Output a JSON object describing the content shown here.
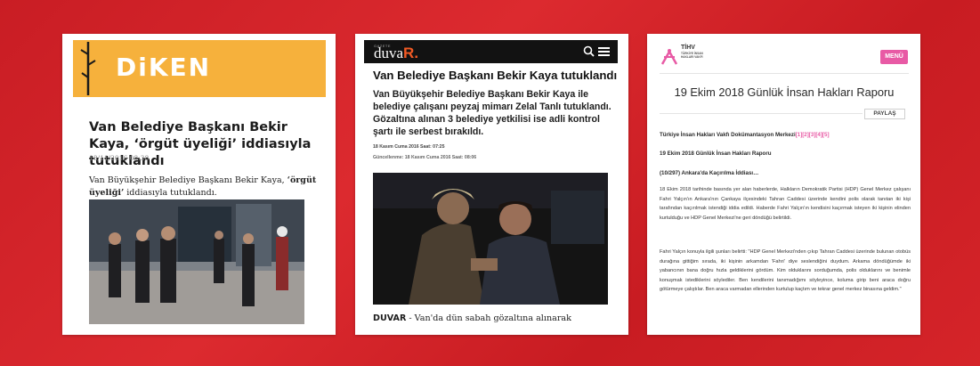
{
  "card_diken": {
    "logo": "DiKEN",
    "title": "Van Belediye Başkanı Bekir Kaya, ‘örgüt üyeliği’ iddiasıyla tutuklandı",
    "date": "18/11/2016 08:38",
    "lead_plain": "Van Büyükşehir Belediye Başkanı Bekir Kaya, ",
    "lead_bold": "‘örgüt üyeliği’",
    "lead_tail": " iddiasıyla tutuklandı.",
    "photo_icon": "news-photo-arrest-crowd"
  },
  "card_duvar": {
    "logo_sup": "GAZETE",
    "logo_main": "duva",
    "logo_r": "R.",
    "icons": [
      "search-icon",
      "menu-icon"
    ],
    "title": "Van Belediye Başkanı Bekir Kaya tutuklandı",
    "lead": "Van Büyükşehir Belediye Başkanı Bekir Kaya ile belediye çalışanı peyzaj mimarı Zelal Tanlı tutuklandı. Gözaltına alınan 3 belediye yetkilisi ise adli kontrol şartı ile serbest bırakıldı.",
    "meta_published": "18 Kasım Cuma 2016   Saat: 07:25",
    "meta_updated": "Güncellenme: 18 Kasım Cuma 2016   Saat: 08:06",
    "photo_icon": "news-photo-escorted-man",
    "bottom_source": "DUVAR",
    "bottom_text": " - Van'da dün sabah gözaltına alınarak"
  },
  "card_tihv": {
    "logo_big": "TİHV",
    "logo_small": "TÜRKİYE İNSAN HAKLARI VAKFI",
    "menu_label": "MENÜ",
    "title": "19 Ekim 2018 Günlük İnsan Hakları Raporu",
    "share_label": "PAYLAŞ",
    "source_line": "Türkiye İnsan Hakları Vakfı Dokümantasyon Merkezi",
    "footnotes": "[1][2][3][4][5]",
    "report_line": "19 Ekim 2018 Günlük İnsan Hakları Raporu",
    "section_heading": "(10/297) Ankara'da Kaçırılma İddiası…",
    "para1": "18 Ekim 2018 tarihinde basında yer alan haberlerde, Halkların Demokratik Partisi (HDP) Genel Merkez çalışanı Fahri Yalçın'ın Ankara'nın Çankaya ilçesindeki Tahran Caddesi üzerinde kendini polis olarak tanıtan iki kişi tarafından kaçırılmak istendiği iddia edildi. Haberde Fahri Yalçın'ın kendisini kaçırmak isteyen iki kişinin elinden kurtulduğu ve HDP Genel Merkezi'ne geri döndüğü belirtildi.",
    "para2": "Fahri Yalçın konuyla ilgili şunları belirtti: \"HDP Genel Merkezi'nden çıkıp Tahran Caddesi üzerinde bulunan otobüs durağına gittiğim sırada, iki kişinin arkamdan 'Fahri' diye seslendiğini duydum. Arkama döndüğümde iki yabancının bana doğru hızla geldiklerini gördüm. Kim olduklarını sorduğumda, polis olduklarını ve benimle konuşmak istediklerini söylediler. Ben kendilerini tanımadığımı söyleyince, koluma girip beni araca doğru götürmeye çalıştılar. Ben araca varmadan ellerinden kurtulup kaçtım ve tekrar genel merkez binasına geldim.\""
  },
  "colors": {
    "background": "#d42027",
    "diken_orange": "#f6b13c",
    "duvar_accent": "#f15a24",
    "tihv_pink": "#e85aa5"
  }
}
